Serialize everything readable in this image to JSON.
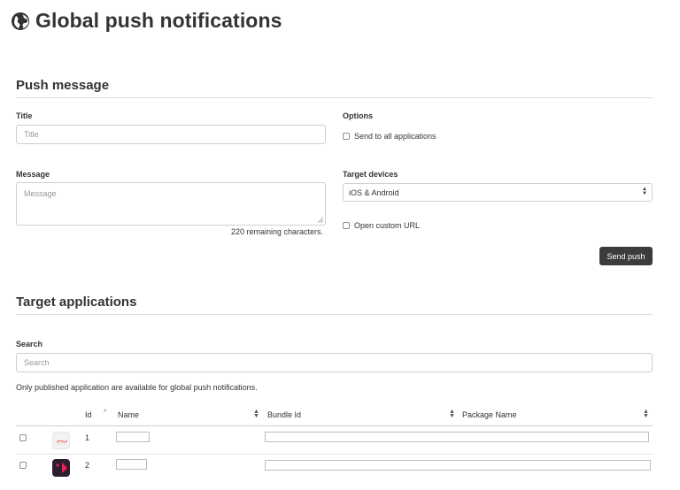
{
  "header": {
    "title": "Global push notifications",
    "icon": "globe-icon"
  },
  "push_message": {
    "section_title": "Push message",
    "title_label": "Title",
    "title_placeholder": "Title",
    "message_label": "Message",
    "message_placeholder": "Message",
    "remaining": "220 remaining characters.",
    "options_label": "Options",
    "send_all_label": "Send to all applications",
    "target_devices_label": "Target devices",
    "target_devices_value": "iOS & Android",
    "open_url_label": "Open custom URL",
    "send_button": "Send push"
  },
  "target_apps": {
    "section_title": "Target applications",
    "search_label": "Search",
    "search_placeholder": "Search",
    "note": "Only published application are available for global push notifications.",
    "columns": [
      "Id",
      "Name",
      "Bundle Id",
      "Package Name"
    ],
    "rows": [
      {
        "id": "1",
        "icon": "app-logo-red-icon"
      },
      {
        "id": "2",
        "icon": "app-logo-dark-pink-icon"
      }
    ]
  },
  "colors": {
    "button_bg": "#3c3c3c",
    "border": "#cfcfcf",
    "app2_icon": "#2b1f2e",
    "app2_accent": "#e8245a"
  }
}
